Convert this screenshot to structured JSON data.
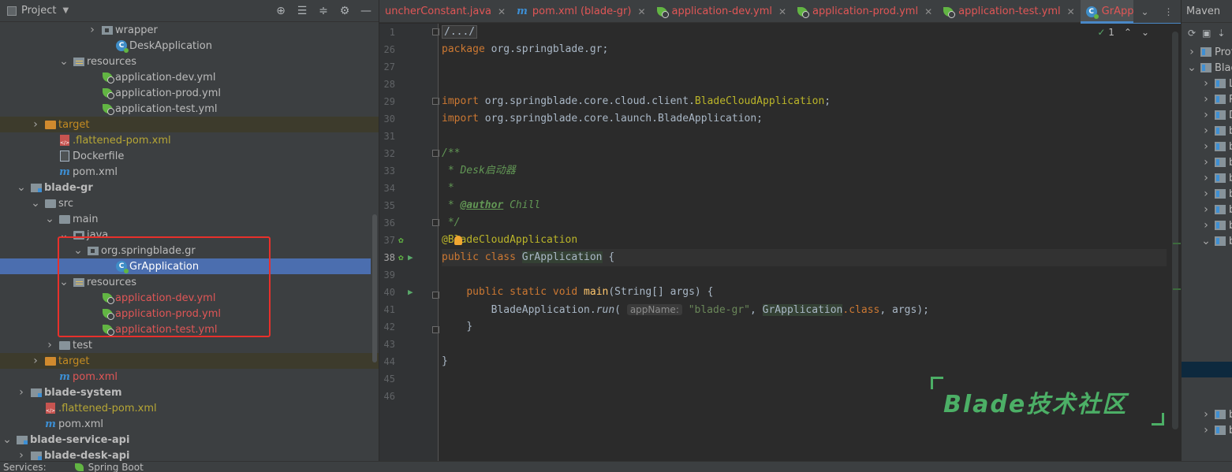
{
  "project": {
    "title": "Project",
    "header_icons": [
      "crosshair-icon",
      "expand-all-icon",
      "collapse-all-icon",
      "gear-icon",
      "minimize-icon"
    ],
    "tree": [
      {
        "label": "wrapper",
        "depth": 7,
        "arrow": "right",
        "icon": "package"
      },
      {
        "label": "DeskApplication",
        "depth": 8,
        "arrow": "none",
        "icon": "class"
      },
      {
        "label": "resources",
        "depth": 5,
        "arrow": "down",
        "icon": "resources"
      },
      {
        "label": "application-dev.yml",
        "depth": 7,
        "arrow": "none",
        "icon": "spring"
      },
      {
        "label": "application-prod.yml",
        "depth": 7,
        "arrow": "none",
        "icon": "spring"
      },
      {
        "label": "application-test.yml",
        "depth": 7,
        "arrow": "none",
        "icon": "spring"
      },
      {
        "label": "target",
        "depth": 3,
        "arrow": "right",
        "icon": "folder-orange",
        "style": "orange",
        "excluded": true
      },
      {
        "label": ".flattened-pom.xml",
        "depth": 4,
        "arrow": "none",
        "icon": "xml",
        "style": "olive"
      },
      {
        "label": "Dockerfile",
        "depth": 4,
        "arrow": "none",
        "icon": "docker"
      },
      {
        "label": "pom.xml",
        "depth": 4,
        "arrow": "none",
        "icon": "maven"
      },
      {
        "label": "blade-gr",
        "depth": 2,
        "arrow": "down",
        "icon": "module",
        "style": "bold"
      },
      {
        "label": "src",
        "depth": 3,
        "arrow": "down",
        "icon": "folder"
      },
      {
        "label": "main",
        "depth": 4,
        "arrow": "down",
        "icon": "folder"
      },
      {
        "label": "java",
        "depth": 5,
        "arrow": "down",
        "icon": "folder-src"
      },
      {
        "label": "org.springblade.gr",
        "depth": 6,
        "arrow": "down",
        "icon": "package"
      },
      {
        "label": "GrApplication",
        "depth": 8,
        "arrow": "none",
        "icon": "class",
        "selected": true
      },
      {
        "label": "resources",
        "depth": 5,
        "arrow": "down",
        "icon": "resources"
      },
      {
        "label": "application-dev.yml",
        "depth": 7,
        "arrow": "none",
        "icon": "spring",
        "style": "red"
      },
      {
        "label": "application-prod.yml",
        "depth": 7,
        "arrow": "none",
        "icon": "spring",
        "style": "red"
      },
      {
        "label": "application-test.yml",
        "depth": 7,
        "arrow": "none",
        "icon": "spring",
        "style": "red"
      },
      {
        "label": "test",
        "depth": 4,
        "arrow": "right",
        "icon": "folder"
      },
      {
        "label": "target",
        "depth": 3,
        "arrow": "right",
        "icon": "folder-orange",
        "style": "orange",
        "excluded": true
      },
      {
        "label": "pom.xml",
        "depth": 4,
        "arrow": "none",
        "icon": "maven",
        "style": "red"
      },
      {
        "label": "blade-system",
        "depth": 2,
        "arrow": "right",
        "icon": "module",
        "style": "bold"
      },
      {
        "label": ".flattened-pom.xml",
        "depth": 3,
        "arrow": "none",
        "icon": "xml",
        "style": "olive"
      },
      {
        "label": "pom.xml",
        "depth": 3,
        "arrow": "none",
        "icon": "maven"
      },
      {
        "label": "blade-service-api",
        "depth": 1,
        "arrow": "down",
        "icon": "module",
        "style": "bold"
      },
      {
        "label": "blade-desk-api",
        "depth": 2,
        "arrow": "right",
        "icon": "module",
        "style": "bold"
      }
    ]
  },
  "tabs": [
    {
      "label": "uncherConstant.java",
      "icon": "none"
    },
    {
      "label": "pom.xml (blade-gr)",
      "icon": "maven"
    },
    {
      "label": "application-dev.yml",
      "icon": "spring"
    },
    {
      "label": "application-prod.yml",
      "icon": "spring"
    },
    {
      "label": "application-test.yml",
      "icon": "spring"
    },
    {
      "label": "GrApplication.java",
      "icon": "class",
      "active": true
    }
  ],
  "editor": {
    "inspection": {
      "ok_count": "1"
    },
    "line_numbers": [
      "1",
      "26",
      "27",
      "28",
      "29",
      "30",
      "31",
      "32",
      "33",
      "34",
      "35",
      "36",
      "37",
      "38",
      "39",
      "40",
      "41",
      "42",
      "43",
      "44",
      "45",
      "46"
    ],
    "current_line": "38",
    "code": {
      "fold": "/.../",
      "package_kw": "package",
      "package_name": " org.springblade.gr;",
      "import_kw": "import",
      "import1": " org.springblade.core.cloud.client.",
      "import1_cls": "BladeCloudApplication",
      "import2": " org.springblade.core.launch.BladeApplication;",
      "doc_open": "/**",
      "doc_title": " * Desk启动器",
      "doc_blank": " *",
      "doc_author_pre": " * ",
      "doc_author_tag": "@author",
      "doc_author_name": " Chill",
      "doc_close": " */",
      "annotation": "@BladeCloudApplication",
      "public_kw": "public",
      "class_kw": "class",
      "class_name": "GrApplication",
      "open_brace": " {",
      "static_kw": "static",
      "void_kw": "void",
      "main_fn": "main",
      "main_params": "(String[] args) {",
      "run_obj": "BladeApplication.",
      "run_fn": "run",
      "hint": "appName:",
      "arg_str": "\"blade-gr\"",
      "arg_cls": "GrApplication",
      "arg_dot_class": ".class",
      "arg_rest": ", args);",
      "close_brace": "}"
    }
  },
  "watermark": {
    "text": "Blade技术社区"
  },
  "maven": {
    "title": "Maven",
    "rows": [
      "Prof",
      "Blac",
      "L",
      "R",
      "D",
      "b",
      "b",
      "b",
      "b",
      "b",
      "b",
      "b",
      "b",
      "b",
      "b"
    ]
  },
  "bottom": {
    "services": "Services:",
    "spring": "Spring Boot"
  }
}
